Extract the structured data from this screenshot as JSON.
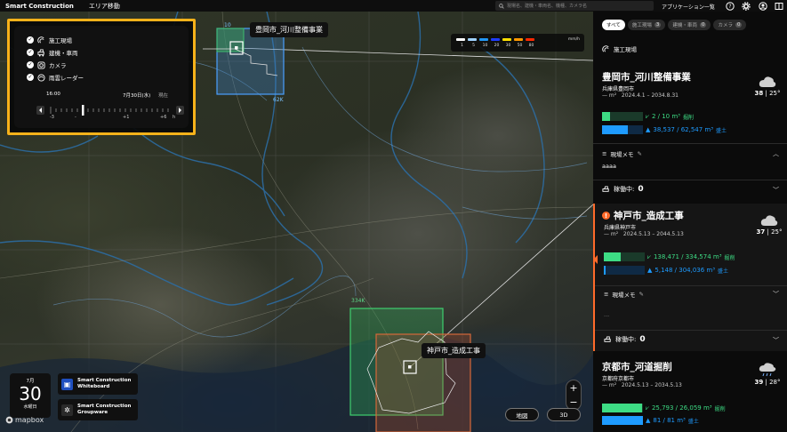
{
  "topbar": {
    "brand": "Smart Construction",
    "area_menu": "エリア移動",
    "search_placeholder": "現場名、建機・車両名、機種、カメラ名",
    "apps_label": "アプリケーション一覧",
    "icons": [
      "help-icon",
      "gear-icon",
      "user-icon",
      "panel-toggle-icon"
    ]
  },
  "layers": {
    "items": [
      {
        "label": "施工現場",
        "checked": true,
        "icon": "site-icon"
      },
      {
        "label": "建機・車両",
        "checked": true,
        "icon": "vehicle-icon"
      },
      {
        "label": "カメラ",
        "checked": true,
        "icon": "camera-icon"
      },
      {
        "label": "雨雲レーダー",
        "checked": true,
        "icon": "rain-radar-icon"
      }
    ],
    "time": "16:00",
    "date": "7月30日(水)",
    "now_label": "現在",
    "ticks": [
      "-3",
      "-",
      "+1",
      "+6",
      "h"
    ]
  },
  "legend": {
    "levels": [
      "1",
      "5",
      "10",
      "20",
      "30",
      "50",
      "80"
    ],
    "unit": "mm/h",
    "colors": [
      "#ffffff",
      "#a0d2ff",
      "#2196f3",
      "#1e3cff",
      "#ffe000",
      "#ff9900",
      "#ff2800"
    ]
  },
  "map": {
    "project1_label": "豊岡市_河川整備事業",
    "project1_area": "10",
    "project1_area2": "62K",
    "project2_label": "神戸市_造成工事",
    "project2_area": "334K",
    "zoom_in": "+",
    "zoom_out": "−",
    "view_map": "地図",
    "view_3d": "3D",
    "attribution": "mapbox"
  },
  "calendar": {
    "month": "7月",
    "day": "30",
    "weekday": "水曜日"
  },
  "apps": [
    {
      "line1": "Smart Construction",
      "line2": "Whiteboard"
    },
    {
      "line1": "Smart Construction",
      "line2": "Groupware"
    }
  ],
  "panel": {
    "tabs": [
      {
        "label": "すべて",
        "count": ""
      },
      {
        "label": "施工現場",
        "count": "3"
      },
      {
        "label": "建機・車両",
        "count": "0"
      },
      {
        "label": "カメラ",
        "count": "0"
      }
    ],
    "section": "施工現場",
    "projects": [
      {
        "name": "豊岡市_河川整備事業",
        "pref": "兵庫県豊岡市",
        "area": "— m²",
        "period": "2024.4.1 – 2034.8.31",
        "temp_hi": "38",
        "temp_lo": "25°",
        "excav": "2 / 10 m³",
        "excav_label": "掘削",
        "fill": "38,537 / 62,547 m³",
        "fill_label": "盛土",
        "excav_pct": 0.2,
        "fill_pct": 0.62,
        "memo_label": "現場メモ",
        "memo_text": "aaaa",
        "active_label": "稼働中:",
        "active_count": "0"
      },
      {
        "name": "神戸市_造成工事",
        "pref": "兵庫県神戸市",
        "area": "— m²",
        "period": "2024.5.13 – 2044.5.13",
        "temp_hi": "37",
        "temp_lo": "25°",
        "excav": "138,471 / 334,574 m³",
        "excav_label": "掘削",
        "fill": "5,148 / 304,036 m³",
        "fill_label": "盛土",
        "excav_pct": 0.41,
        "fill_pct": 0.02,
        "memo_label": "現場メモ",
        "memo_text": "...",
        "active_label": "稼働中:",
        "active_count": "0"
      },
      {
        "name": "京都市_河道掘削",
        "pref": "京都府京都市",
        "area": "— m²",
        "period": "2024.5.13 – 2034.5.13",
        "temp_hi": "39",
        "temp_lo": "28°",
        "excav": "25,793 / 26,059 m³",
        "excav_label": "掘削",
        "fill": "81 / 81 m³",
        "fill_label": "盛土",
        "excav_pct": 0.99,
        "fill_pct": 1.0
      }
    ]
  }
}
